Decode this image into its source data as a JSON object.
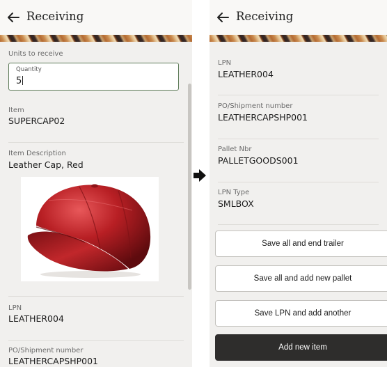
{
  "left_screen": {
    "title": "Receiving",
    "units_to_receive_label": "Units to receive",
    "quantity_field": {
      "label": "Quantity",
      "value": "5"
    },
    "item": {
      "label": "Item",
      "value": "SUPERCAP02"
    },
    "item_description": {
      "label": "Item Description",
      "value": "Leather Cap, Red"
    },
    "product_image": {
      "icon": "red-leather-cap-photo"
    },
    "lpn": {
      "label": "LPN",
      "value": "LEATHER004"
    },
    "po_shipment": {
      "label": "PO/Shipment number",
      "value": "LEATHERCAPSHP001"
    }
  },
  "transition_icon": "right-arrow-icon",
  "right_screen": {
    "title": "Receiving",
    "lpn": {
      "label": "LPN",
      "value": "LEATHER004"
    },
    "po_shipment": {
      "label": "PO/Shipment number",
      "value": "LEATHERCAPSHP001"
    },
    "pallet_nbr": {
      "label": "Pallet Nbr",
      "value": "PALLETGOODS001"
    },
    "lpn_type": {
      "label": "LPN Type",
      "value": "SMLBOX"
    },
    "buttons": {
      "save_end_trailer": "Save all and end trailer",
      "save_add_pallet": "Save all and add new pallet",
      "save_lpn_add_another": "Save LPN and add another",
      "add_new_item": "Add new item"
    }
  },
  "colors": {
    "panel_background": "#f1f0ee",
    "primary_button": "#2e2d2c",
    "input_border": "#5d7a58",
    "product_red": "#b81f24"
  }
}
